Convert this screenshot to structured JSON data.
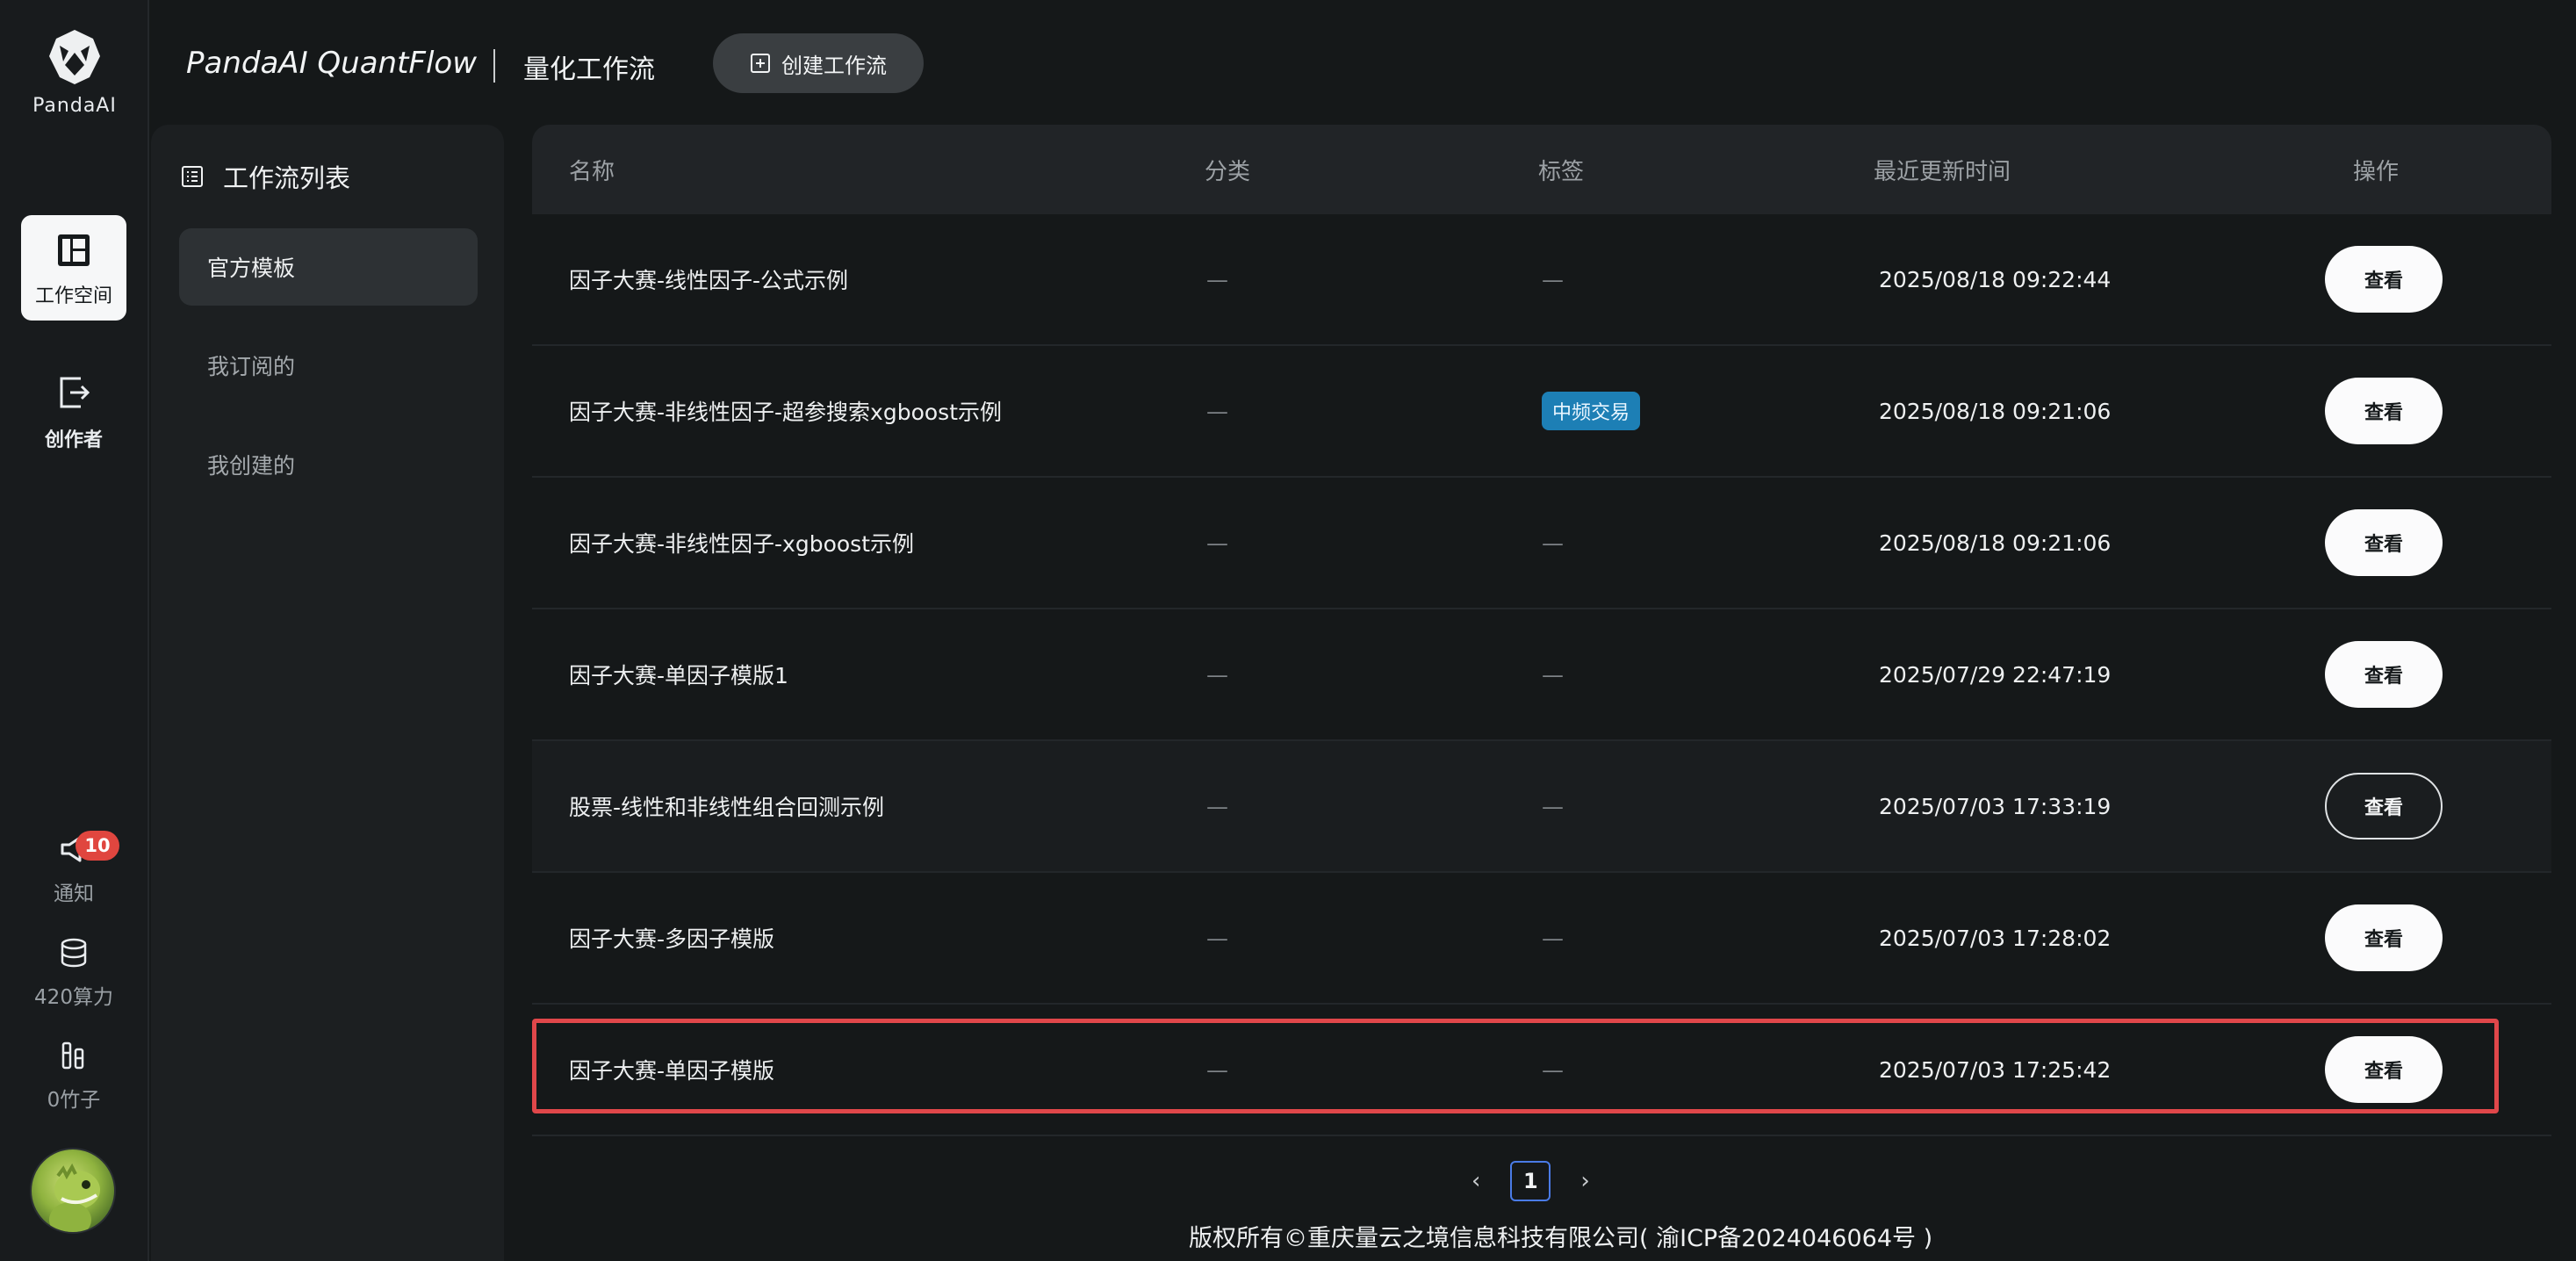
{
  "app": {
    "logo_text": "PandaAI"
  },
  "rail": {
    "workspace_label": "工作空间",
    "creator_label": "创作者",
    "notice_label": "通知",
    "notice_count": "10",
    "compute_label": "420算力",
    "bamboo_label": "0竹子"
  },
  "header": {
    "brand": "PandaAI QuantFlow",
    "subtitle": "量化工作流",
    "create_button": "创建工作流"
  },
  "side_panel": {
    "title": "工作流列表",
    "items": [
      "官方模板",
      "我订阅的",
      "我创建的"
    ],
    "active_index": 0
  },
  "table": {
    "columns": [
      "名称",
      "分类",
      "标签",
      "最近更新时间",
      "操作"
    ],
    "rows": [
      {
        "name": "因子大赛-线性因子-公式示例",
        "category": "—",
        "tag": "—",
        "updated": "2025/08/18 09:22:44",
        "action": "查看"
      },
      {
        "name": "因子大赛-非线性因子-超参搜索xgboost示例",
        "category": "—",
        "tag": "中频交易",
        "updated": "2025/08/18 09:21:06",
        "action": "查看"
      },
      {
        "name": "因子大赛-非线性因子-xgboost示例",
        "category": "—",
        "tag": "—",
        "updated": "2025/08/18 09:21:06",
        "action": "查看"
      },
      {
        "name": "因子大赛-单因子模版1",
        "category": "—",
        "tag": "—",
        "updated": "2025/07/29 22:47:19",
        "action": "查看"
      },
      {
        "name": "股票-线性和非线性组合回测示例",
        "category": "—",
        "tag": "—",
        "updated": "2025/07/03 17:33:19",
        "action": "查看"
      },
      {
        "name": "因子大赛-多因子模版",
        "category": "—",
        "tag": "—",
        "updated": "2025/07/03 17:28:02",
        "action": "查看"
      },
      {
        "name": "因子大赛-单因子模版",
        "category": "—",
        "tag": "—",
        "updated": "2025/07/03 17:25:42",
        "action": "查看"
      }
    ]
  },
  "pagination": {
    "prev": "‹",
    "current": "1",
    "next": "›"
  },
  "footer": {
    "text": "版权所有©重庆量云之境信息科技有限公司( 渝ICP备2024046064号 )"
  },
  "colors": {
    "accent_tag": "#1d7fb5",
    "highlight_frame": "#e0474a",
    "badge": "#e0463f"
  }
}
